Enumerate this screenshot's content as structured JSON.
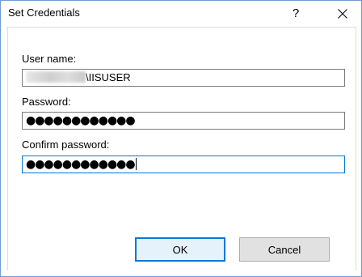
{
  "window": {
    "title": "Set Credentials",
    "help_label": "?",
    "close_icon": "close-icon"
  },
  "form": {
    "username": {
      "label": "User name:",
      "value_visible": "\\IISUSER"
    },
    "password": {
      "label": "Password:",
      "masked_value": "●●●●●●●●●●●●"
    },
    "confirm_password": {
      "label": "Confirm password:",
      "masked_value": "●●●●●●●●●●●●"
    }
  },
  "buttons": {
    "ok_label": "OK",
    "cancel_label": "Cancel"
  },
  "colors": {
    "accent": "#0078d7",
    "window_border": "#6d9ccf",
    "button_face": "#e1e1e1"
  }
}
